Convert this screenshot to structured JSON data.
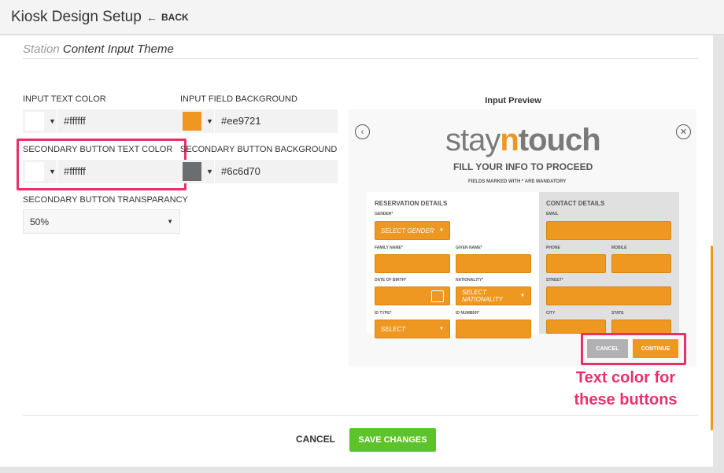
{
  "header": {
    "title": "Kiosk Design Setup",
    "back_label": "BACK"
  },
  "section": {
    "title_muted": "Station",
    "title_main": "Content Input Theme"
  },
  "fields": {
    "input_text_color": {
      "label": "INPUT TEXT COLOR",
      "value": "#ffffff",
      "swatch": "#ffffff"
    },
    "input_field_background": {
      "label": "INPUT FIELD BACKGROUND",
      "value": "#ee9721",
      "swatch": "#ee9721"
    },
    "secondary_button_text_color": {
      "label": "SECONDARY BUTTON TEXT COLOR",
      "value": "#ffffff",
      "swatch": "#ffffff"
    },
    "secondary_button_background": {
      "label": "SECONDARY BUTTON BACKGROUND",
      "value": "#6c6d70",
      "swatch": "#6c6d70"
    },
    "secondary_button_transparancy": {
      "label": "SECONDARY BUTTON TRANSPARANCY",
      "value": "50%"
    }
  },
  "preview": {
    "heading": "Input Preview",
    "logo_prefix": "stay",
    "logo_accent": "n",
    "logo_suffix": "touch",
    "title": "FILL YOUR INFO TO PROCEED",
    "note": "FIELDS MARKED WITH * ARE MANDATORY",
    "reservation": {
      "title": "RESERVATION DETAILS",
      "gender_label": "GENDER*",
      "gender_value": "SELECT GENDER",
      "family_name_label": "FAMILY NAME*",
      "given_name_label": "GIVEN NAME*",
      "dob_label": "DATE OF BIRTH*",
      "nationality_label": "NATIONALITY*",
      "nationality_value": "SELECT NATIONALITY",
      "id_type_label": "ID TYPE*",
      "id_type_value": "SELECT",
      "id_number_label": "ID NUMBER*"
    },
    "contact": {
      "title": "CONTACT DETAILS",
      "email_label": "EMAIL",
      "phone_label": "PHONE",
      "mobile_label": "MOBILE",
      "street_label": "STREET*",
      "city_label": "CITY",
      "state_label": "STATE"
    },
    "cancel_label": "CANCEL",
    "continue_label": "CONTINUE"
  },
  "annotation": {
    "line1": "Text color for",
    "line2": "these buttons"
  },
  "footer": {
    "cancel_label": "CANCEL",
    "save_label": "SAVE CHANGES"
  },
  "colors": {
    "accent": "#ee9721",
    "highlight": "#e8316b",
    "save": "#5cc32b",
    "secondary_bg": "#6c6d70"
  },
  "icons": {
    "back": "arrow-left-icon",
    "prev": "chevron-left-circle-icon",
    "close": "close-circle-icon",
    "calendar": "calendar-icon"
  }
}
